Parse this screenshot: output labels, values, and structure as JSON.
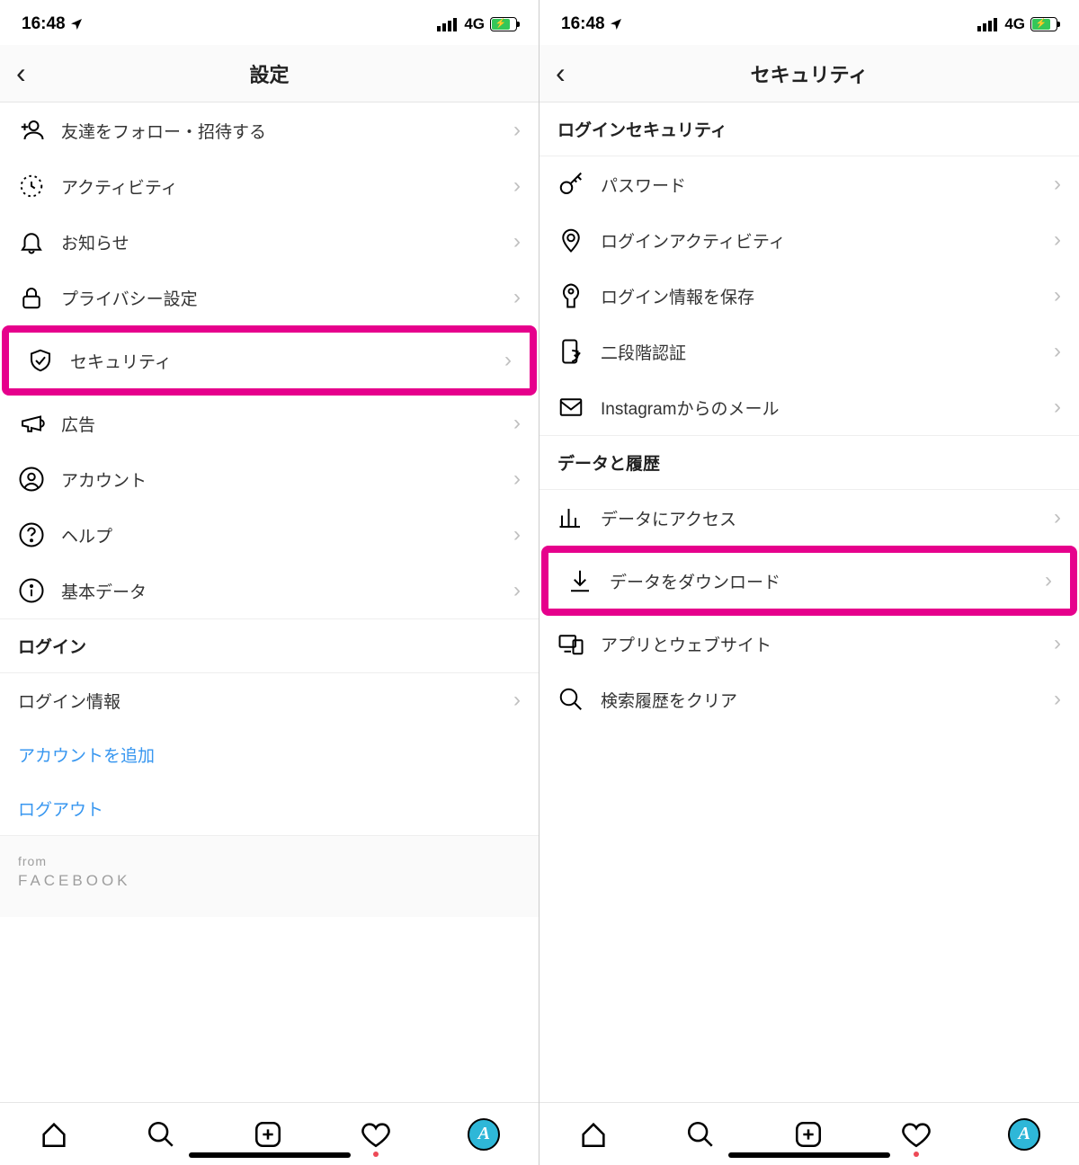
{
  "status": {
    "time": "16:48",
    "network": "4G"
  },
  "left": {
    "title": "設定",
    "items": [
      {
        "icon": "add-user",
        "label": "友達をフォロー・招待する"
      },
      {
        "icon": "activity",
        "label": "アクティビティ"
      },
      {
        "icon": "bell",
        "label": "お知らせ"
      },
      {
        "icon": "lock",
        "label": "プライバシー設定"
      },
      {
        "icon": "shield-check",
        "label": "セキュリティ",
        "highlighted": true
      },
      {
        "icon": "megaphone",
        "label": "広告"
      },
      {
        "icon": "user-circle",
        "label": "アカウント"
      },
      {
        "icon": "help",
        "label": "ヘルプ"
      },
      {
        "icon": "info",
        "label": "基本データ"
      }
    ],
    "loginSection": {
      "header": "ログイン",
      "items": [
        {
          "label": "ログイン情報",
          "chevron": true
        },
        {
          "label": "アカウントを追加",
          "link": true
        },
        {
          "label": "ログアウト",
          "link": true
        }
      ]
    },
    "brand": {
      "from": "from",
      "name": "FACEBOOK"
    }
  },
  "right": {
    "title": "セキュリティ",
    "sections": [
      {
        "header": "ログインセキュリティ",
        "items": [
          {
            "icon": "key",
            "label": "パスワード"
          },
          {
            "icon": "pin",
            "label": "ログインアクティビティ"
          },
          {
            "icon": "keyhole",
            "label": "ログイン情報を保存"
          },
          {
            "icon": "phone-shield",
            "label": "二段階認証"
          },
          {
            "icon": "mail",
            "label": "Instagramからのメール"
          }
        ]
      },
      {
        "header": "データと履歴",
        "items": [
          {
            "icon": "chart",
            "label": "データにアクセス"
          },
          {
            "icon": "download",
            "label": "データをダウンロード",
            "highlighted": true
          },
          {
            "icon": "devices",
            "label": "アプリとウェブサイト"
          },
          {
            "icon": "search",
            "label": "検索履歴をクリア"
          }
        ]
      }
    ]
  }
}
